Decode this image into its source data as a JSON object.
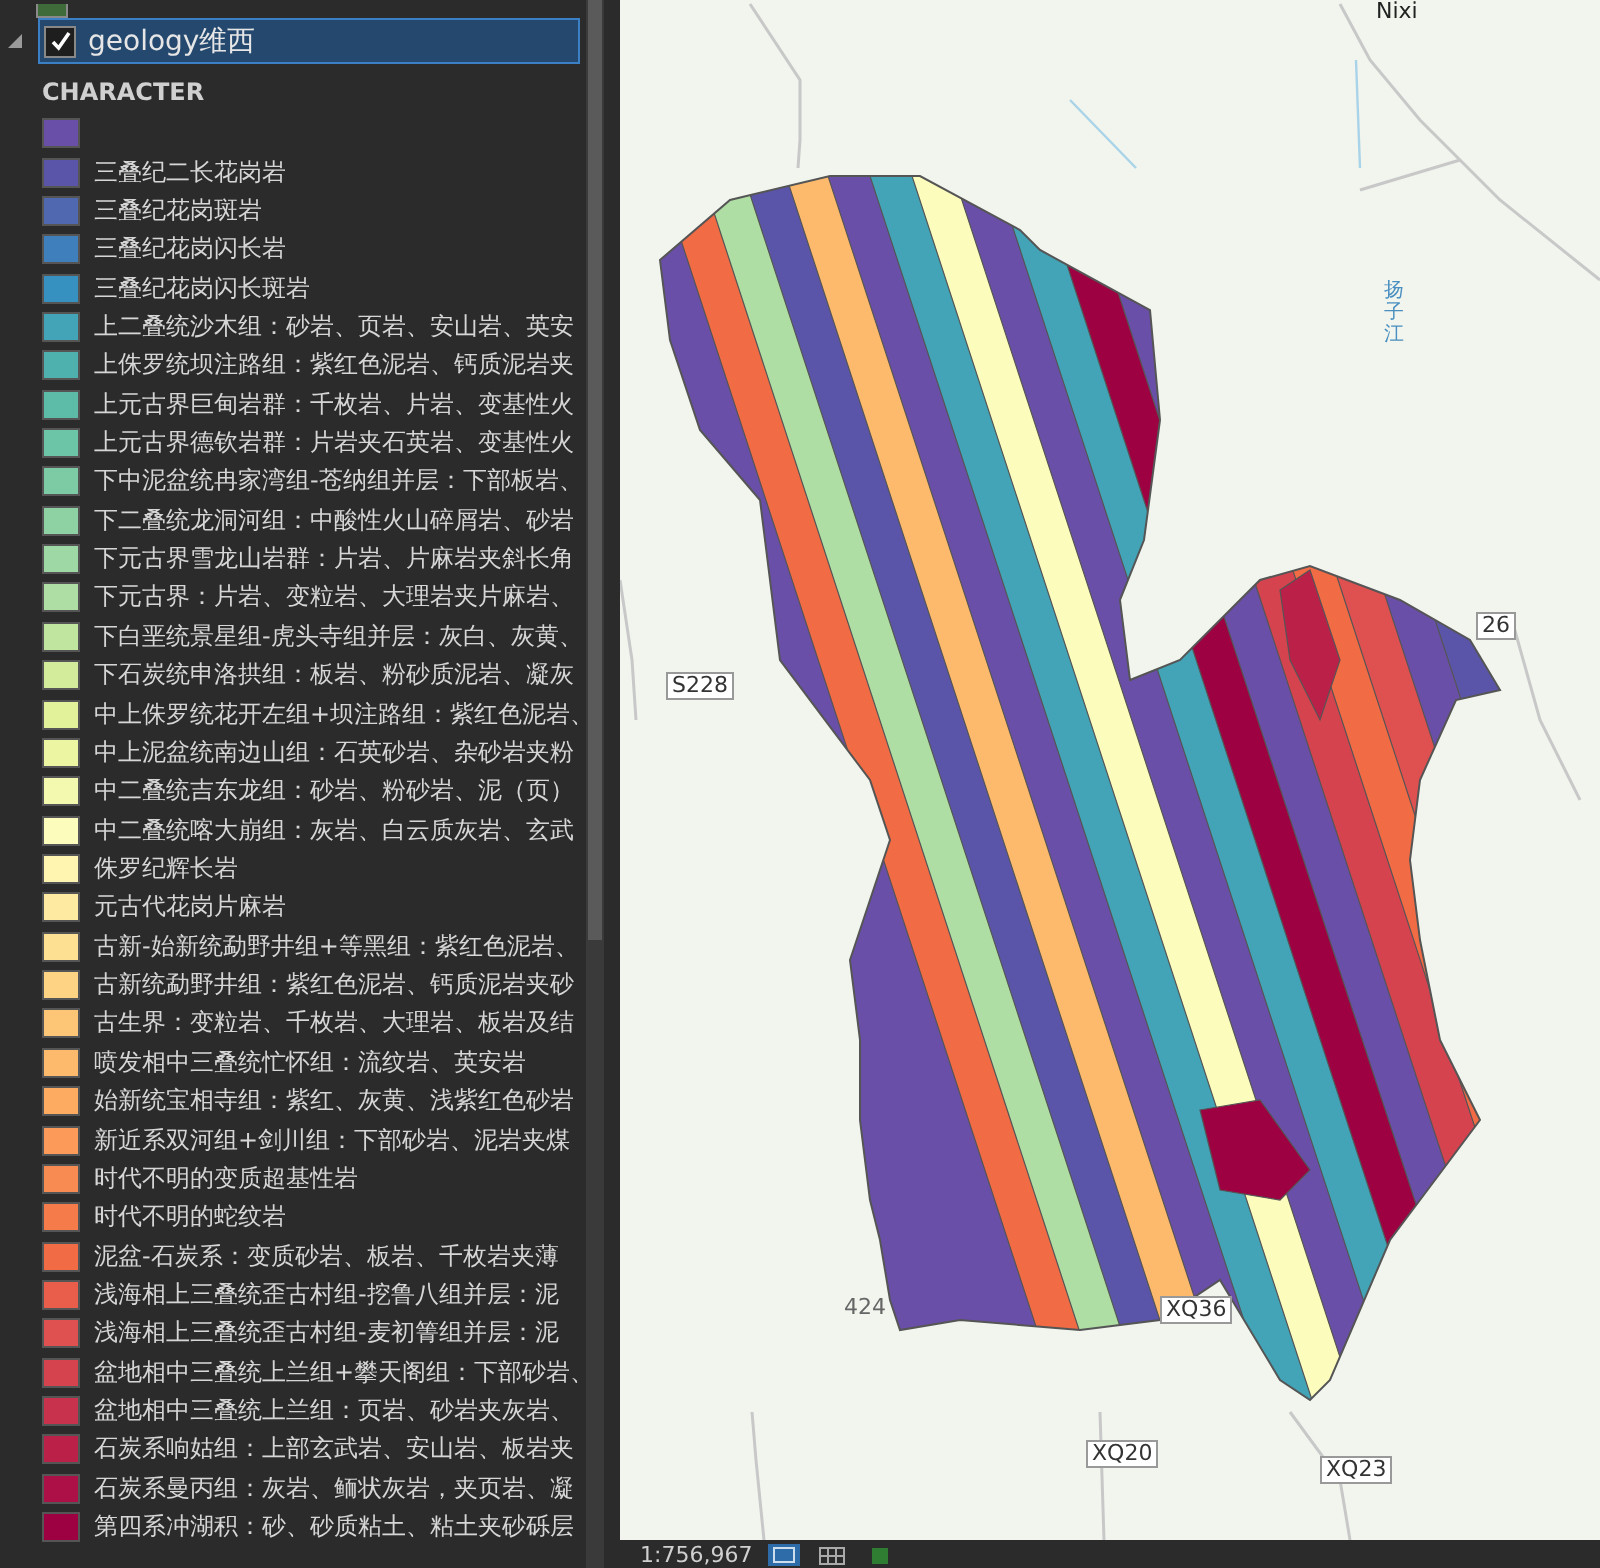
{
  "contents": {
    "layer": {
      "name": "geology维西",
      "checked": true,
      "expanded": true,
      "selected": true
    },
    "field": "CHARACTER",
    "legend": [
      {
        "color": "#6a4fa8"
      },
      {
        "label": "三叠纪二长花岗岩",
        "color": "#5a55a8"
      },
      {
        "label": "三叠纪花岗斑岩",
        "color": "#4f68b0"
      },
      {
        "label": "三叠纪花岗闪长岩",
        "color": "#3f7fbb"
      },
      {
        "label": "三叠纪花岗闪长斑岩",
        "color": "#3690c0"
      },
      {
        "label": "上二叠统沙木组：砂岩、页岩、安山岩、英安",
        "color": "#42a4b6"
      },
      {
        "label": "上侏罗统坝注路组：紫红色泥岩、钙质泥岩夹",
        "color": "#4fb1ae"
      },
      {
        "label": "上元古界巨甸岩群：千枚岩、片岩、变基性火",
        "color": "#5cbca8"
      },
      {
        "label": "上元古界德钦岩群：片岩夹石英岩、变基性火",
        "color": "#6cc5a6"
      },
      {
        "label": "下中泥盆统冉家湾组-苍纳组并层：下部板岩、",
        "color": "#7dcba4"
      },
      {
        "label": "下二叠统龙洞河组：中酸性火山碎屑岩、砂岩",
        "color": "#8ed2a4"
      },
      {
        "label": "下元古界雪龙山岩群：片岩、片麻岩夹斜长角",
        "color": "#9ed8a4"
      },
      {
        "label": "下元古界：片岩、变粒岩、大理岩夹片麻岩、",
        "color": "#aedea3"
      },
      {
        "label": "下白垩统景星组-虎头寺组并层：灰白、灰黄、",
        "color": "#c0e59f"
      },
      {
        "label": "下石炭统申洛拱组：板岩、粉砂质泥岩、凝灰",
        "color": "#d2ec9b"
      },
      {
        "label": "中上侏罗统花开左组+坝注路组：紫红色泥岩、",
        "color": "#e2f29a"
      },
      {
        "label": "中上泥盆统南边山组：石英砂岩、杂砂岩夹粉",
        "color": "#ecf6a2"
      },
      {
        "label": "中二叠统吉东龙组：砂岩、粉砂岩、泥（页）",
        "color": "#f4f9b0"
      },
      {
        "label": "中二叠统喀大崩组：灰岩、白云质灰岩、玄武",
        "color": "#fcfdbd"
      },
      {
        "label": "侏罗纪辉长岩",
        "color": "#fff5b0"
      },
      {
        "label": "元古代花岗片麻岩",
        "color": "#feeaa0"
      },
      {
        "label": "古新-始新统勐野井组+等黑组：紫红色泥岩、",
        "color": "#fee092"
      },
      {
        "label": "古新统勐野井组：紫红色泥岩、钙质泥岩夹砂",
        "color": "#fed383"
      },
      {
        "label": "古生界：变粒岩、千枚岩、大理岩、板岩及结",
        "color": "#fdc677"
      },
      {
        "label": "喷发相中三叠统忙怀组：流纹岩、英安岩",
        "color": "#fdb96c"
      },
      {
        "label": "始新统宝相寺组：紫红、灰黄、浅紫红色砂岩",
        "color": "#fdab60"
      },
      {
        "label": "新近系双河组+剑川组：下部砂岩、泥岩夹煤",
        "color": "#fb9a59"
      },
      {
        "label": "时代不明的变质超基性岩",
        "color": "#f88b51"
      },
      {
        "label": "时代不明的蛇纹岩",
        "color": "#f57b4a"
      },
      {
        "label": "泥盆-石炭系：变质砂岩、板岩、千枚岩夹薄",
        "color": "#f16b45"
      },
      {
        "label": "浅海相上三叠统歪古村组-挖鲁八组并层：泥",
        "color": "#e85e4b"
      },
      {
        "label": "浅海相上三叠统歪古村组-麦初箐组并层：泥",
        "color": "#de5150"
      },
      {
        "label": "盆地相中三叠统上兰组+攀天阁组：下部砂岩、",
        "color": "#d5434f"
      },
      {
        "label": "盆地相中三叠统上兰组：页岩、砂岩夹灰岩、",
        "color": "#c9324d"
      },
      {
        "label": "石炭系响姑组：上部玄武岩、安山岩、板岩夹",
        "color": "#bb2049"
      },
      {
        "label": "石炭系曼丙组：灰岩、鲕状灰岩，夹页岩、凝",
        "color": "#ad1046"
      },
      {
        "label": "第四系冲湖积：砂、砂质粘土、粘土夹砂砾层",
        "color": "#9e0142"
      }
    ]
  },
  "map": {
    "labels": [
      {
        "text": "Nixi",
        "kind": "place"
      },
      {
        "text": "扬子江",
        "kind": "river"
      },
      {
        "text": "S228",
        "kind": "shield"
      },
      {
        "text": "26",
        "kind": "shield"
      },
      {
        "text": "424",
        "kind": "elevation"
      },
      {
        "text": "XQ36",
        "kind": "shield"
      },
      {
        "text": "XQ20",
        "kind": "shield"
      },
      {
        "text": "XQ23",
        "kind": "shield"
      }
    ]
  },
  "status_bar": {
    "scale": "1:756,967"
  }
}
